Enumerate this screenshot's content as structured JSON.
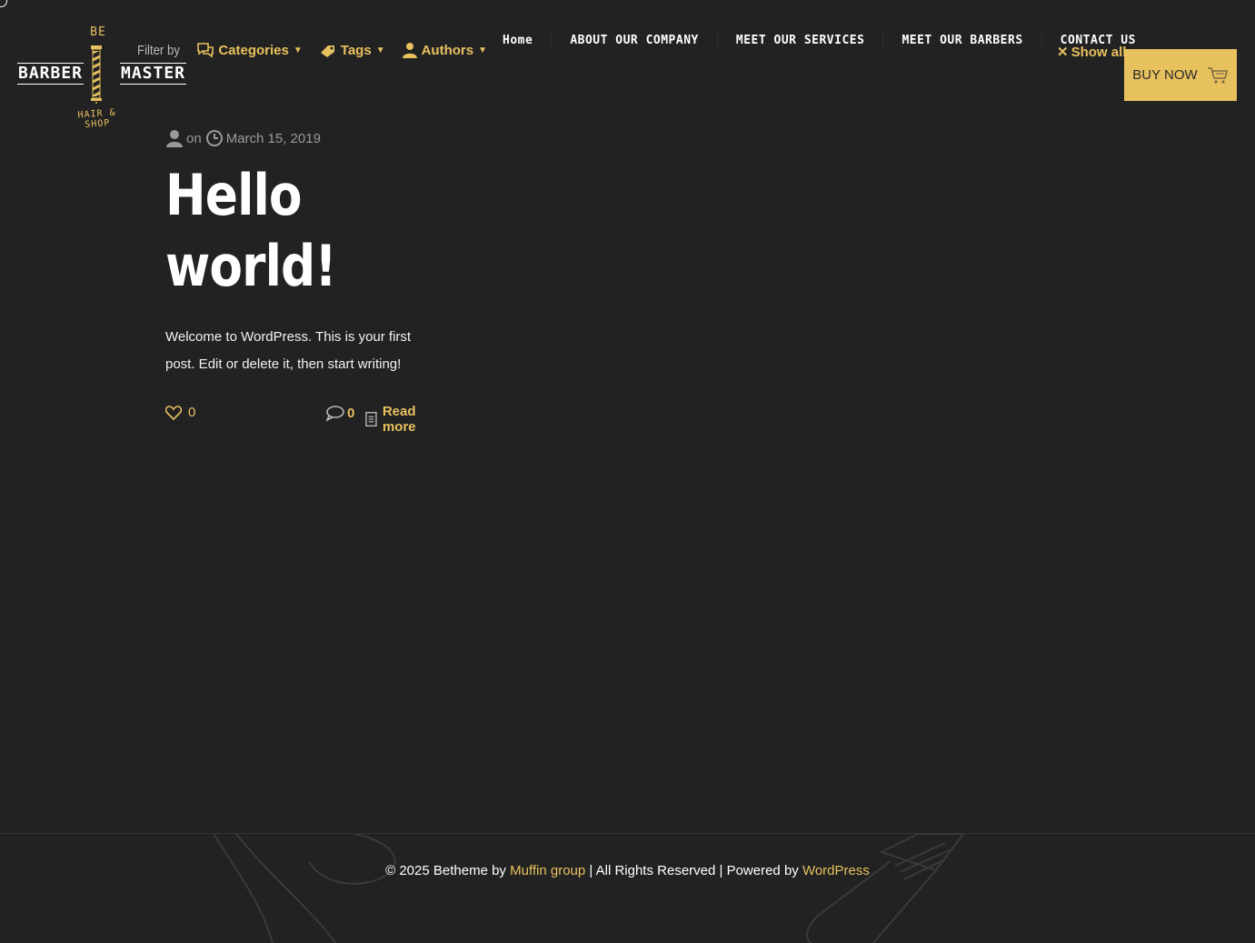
{
  "colors": {
    "background": "#222222",
    "accent": "#e8c15f",
    "text": "#ffffff",
    "muted": "#9a9a9a"
  },
  "logo": {
    "top_text": "BE",
    "left_word": "BARBER",
    "right_word": "MASTER",
    "tagline": "HAIR & SHOP"
  },
  "filter": {
    "label": "Filter by",
    "items": [
      {
        "label": "Categories",
        "icon": "chat-bubbles-icon"
      },
      {
        "label": "Tags",
        "icon": "tag-icon"
      },
      {
        "label": "Authors",
        "icon": "user-icon"
      }
    ],
    "show_all": "Show all"
  },
  "nav": {
    "items": [
      "Home",
      "ABOUT OUR COMPANY",
      "MEET OUR SERVICES",
      "MEET OUR BARBERS",
      "CONTACT US"
    ]
  },
  "buy_button": {
    "label": "BUY NOW",
    "icon": "cart-icon"
  },
  "post": {
    "meta_on": "on",
    "date": "March 15, 2019",
    "title_line1": "Hello",
    "title_line2": "world!",
    "excerpt": "Welcome to WordPress. This is your first post. Edit or delete it, then start writing!",
    "likes": "0",
    "comments": "0",
    "read_more": "Read more"
  },
  "footer": {
    "copyright_prefix": "© 2025 Betheme by ",
    "muffin": "Muffin group",
    "middle": " | All Rights Reserved | Powered by ",
    "wordpress": "WordPress"
  }
}
